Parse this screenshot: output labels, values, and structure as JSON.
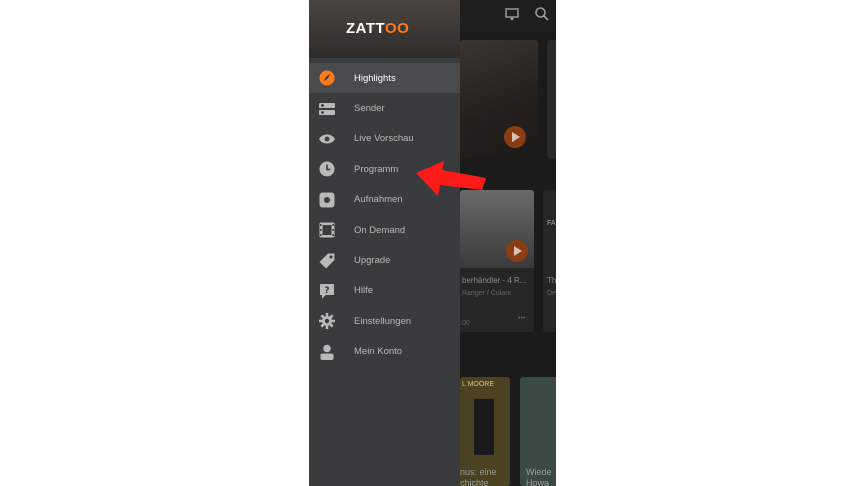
{
  "app": {
    "brand_prefix": "ZATT",
    "brand_oo": "OO"
  },
  "menu": {
    "items": [
      {
        "label": "Highlights",
        "icon": "highlights-icon",
        "active": true
      },
      {
        "label": "Sender",
        "icon": "channels-icon"
      },
      {
        "label": "Live Vorschau",
        "icon": "eye-icon"
      },
      {
        "label": "Programm",
        "icon": "clock-icon"
      },
      {
        "label": "Aufnahmen",
        "icon": "recordings-icon"
      },
      {
        "label": "On Demand",
        "icon": "film-icon"
      },
      {
        "label": "Upgrade",
        "icon": "tag-icon"
      },
      {
        "label": "Hilfe",
        "icon": "help-icon"
      },
      {
        "label": "Einstellungen",
        "icon": "gear-icon"
      },
      {
        "label": "Mein Konto",
        "icon": "account-icon"
      }
    ]
  },
  "background": {
    "card2": {
      "title": "berhändler - 4 R...",
      "sub": "Ranger / Colani",
      "time": ":00"
    },
    "card3": {
      "title": "Th",
      "sub": "De",
      "badge": "FA"
    },
    "card4": {
      "title": "nus: eine",
      "title2": "chichte",
      "badge": "L MOORE"
    },
    "card5": {
      "title": "Wiede",
      "title2": "Howa"
    }
  },
  "annotation": {
    "arrow_color": "#ff1a1a",
    "points_to": "Programm"
  },
  "colors": {
    "accent": "#ff7a1a",
    "drawer_bg": "#3a3b3c",
    "active_item": "#4a4b4c"
  }
}
